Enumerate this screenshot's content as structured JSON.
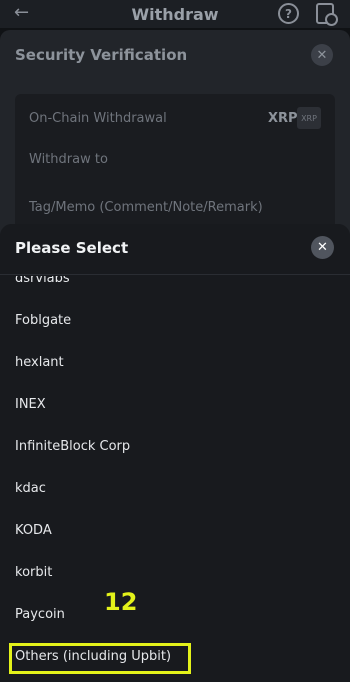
{
  "background": {
    "page_title": "Withdraw",
    "back_icon": "back-arrow-icon",
    "help_icon": "question-icon",
    "history_icon": "history-icon",
    "security": {
      "title": "Security Verification",
      "close_icon": "close-icon",
      "rows": [
        {
          "label": "On-Chain Withdrawal",
          "coin": "XRP",
          "coin_badge": "XRP"
        },
        {
          "label": "Withdraw to"
        },
        {
          "label": "Tag/Memo (Comment/Note/Remark)"
        }
      ]
    }
  },
  "select_sheet": {
    "title": "Please Select",
    "close_icon": "close-icon",
    "options": [
      "dsrvlabs",
      "Foblgate",
      "hexlant",
      "INEX",
      "InfiniteBlock Corp",
      "kdac",
      "KODA",
      "korbit",
      "Paycoin",
      "Others (including Upbit)"
    ]
  },
  "annotation": {
    "label": "12",
    "color": "#e3f21a"
  },
  "colors": {
    "sheet_background": "#181a1e",
    "text_primary": "#e6e8eb",
    "annotation": "#e3f21a"
  }
}
